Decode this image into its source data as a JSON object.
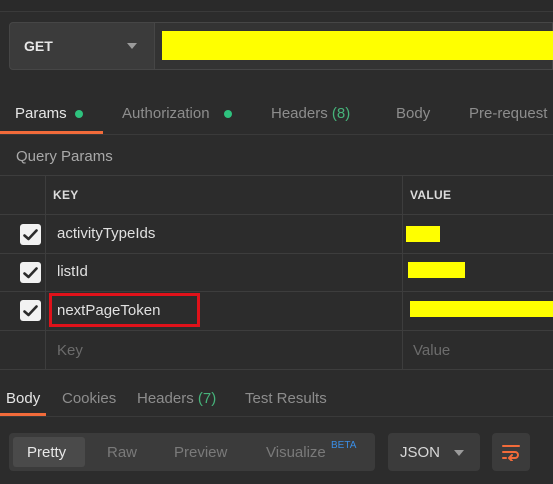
{
  "request": {
    "method": "GET"
  },
  "tabs": [
    {
      "label": "Params"
    },
    {
      "label": "Authorization"
    },
    {
      "label": "Headers",
      "count": "(8)"
    },
    {
      "label": "Body"
    },
    {
      "label": "Pre-request"
    }
  ],
  "query_params": {
    "title": "Query Params",
    "columns": {
      "key": "KEY",
      "value": "VALUE"
    },
    "rows": [
      {
        "key": "activityTypeIds",
        "checked": true
      },
      {
        "key": "listId",
        "checked": true
      },
      {
        "key": "nextPageToken",
        "checked": true
      }
    ],
    "placeholder": {
      "key": "Key",
      "value": "Value"
    }
  },
  "response_tabs": [
    {
      "label": "Body"
    },
    {
      "label": "Cookies"
    },
    {
      "label": "Headers",
      "count": "(7)"
    },
    {
      "label": "Test Results"
    }
  ],
  "format": {
    "options": [
      "Pretty",
      "Raw",
      "Preview",
      "Visualize"
    ],
    "beta": "BETA",
    "language": "JSON"
  },
  "colors": {
    "accent": "#f26b3a",
    "status_dot": "#2ec27e",
    "redaction": "#ffff00",
    "highlight_box": "#e0121a"
  },
  "icons": {
    "wrap": "wrap-lines-icon",
    "caret": "chevron-down-icon",
    "check": "checkmark-icon"
  }
}
